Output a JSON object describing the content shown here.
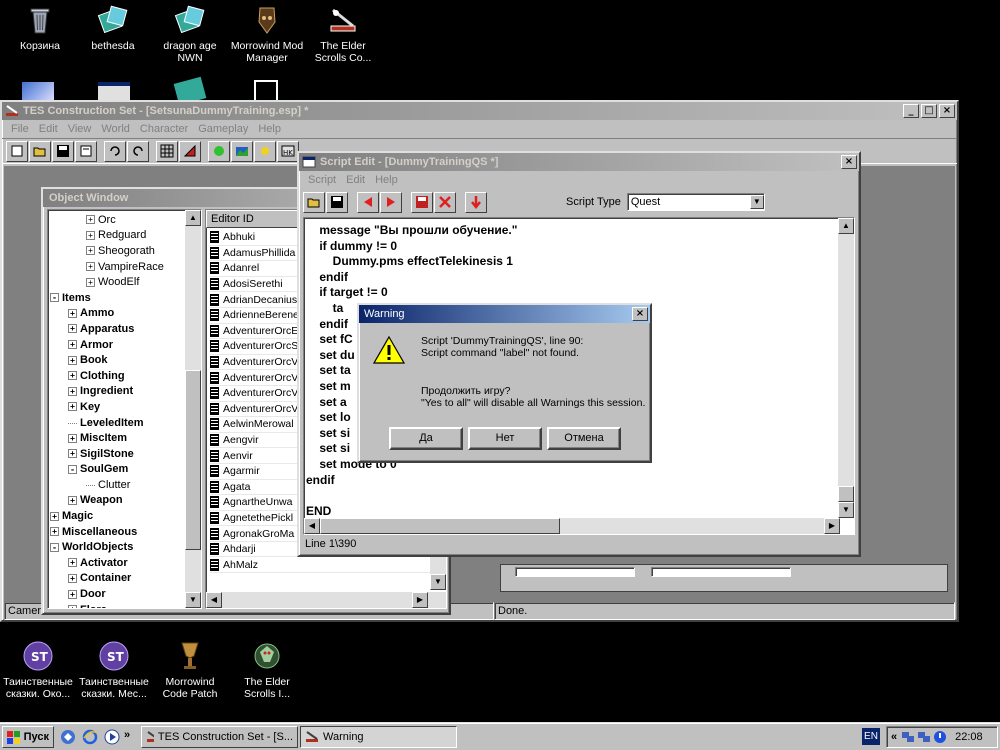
{
  "desktop": {
    "top_icons": [
      {
        "label": "Корзина",
        "icon": "recycle-bin-icon"
      },
      {
        "label": "bethesda",
        "icon": "program-group-icon"
      },
      {
        "label": "dragon age NWN",
        "icon": "program-group-icon"
      },
      {
        "label": "Morrowind Mod Manager",
        "icon": "shield-mask-icon"
      },
      {
        "label": "The Elder Scrolls Co...",
        "icon": "construction-set-icon"
      }
    ],
    "bottom_icons": [
      {
        "label": "Таинственные сказки. Око...",
        "icon": "disc-icon"
      },
      {
        "label": "Таинственные сказки. Мес...",
        "icon": "disc-icon"
      },
      {
        "label": "Morrowind Code Patch",
        "icon": "goblet-icon"
      },
      {
        "label": "The Elder Scrolls I...",
        "icon": "dragon-icon"
      }
    ]
  },
  "main_window": {
    "title": "TES Construction Set - [SetsunaDummyTraining.esp] *",
    "menu": [
      "File",
      "Edit",
      "View",
      "World",
      "Character",
      "Gameplay",
      "Help"
    ],
    "status_left": "Camera",
    "status_right": "Done."
  },
  "object_window": {
    "title": "Object Window",
    "column_header": "Editor ID",
    "tree": [
      {
        "label": "Orc",
        "indent": 2,
        "toggle": "+",
        "bold": false
      },
      {
        "label": "Redguard",
        "indent": 2,
        "toggle": "+",
        "bold": false
      },
      {
        "label": "Sheogorath",
        "indent": 2,
        "toggle": "+",
        "bold": false
      },
      {
        "label": "VampireRace",
        "indent": 2,
        "toggle": "+",
        "bold": false
      },
      {
        "label": "WoodElf",
        "indent": 2,
        "toggle": "+",
        "bold": false
      },
      {
        "label": "Items",
        "indent": 0,
        "toggle": "-",
        "bold": true
      },
      {
        "label": "Ammo",
        "indent": 1,
        "toggle": "+",
        "bold": true
      },
      {
        "label": "Apparatus",
        "indent": 1,
        "toggle": "+",
        "bold": true
      },
      {
        "label": "Armor",
        "indent": 1,
        "toggle": "+",
        "bold": true
      },
      {
        "label": "Book",
        "indent": 1,
        "toggle": "+",
        "bold": true
      },
      {
        "label": "Clothing",
        "indent": 1,
        "toggle": "+",
        "bold": true
      },
      {
        "label": "Ingredient",
        "indent": 1,
        "toggle": "+",
        "bold": true
      },
      {
        "label": "Key",
        "indent": 1,
        "toggle": "+",
        "bold": true
      },
      {
        "label": "LeveledItem",
        "indent": 1,
        "toggle": "",
        "bold": true
      },
      {
        "label": "MiscItem",
        "indent": 1,
        "toggle": "+",
        "bold": true
      },
      {
        "label": "SigilStone",
        "indent": 1,
        "toggle": "+",
        "bold": true
      },
      {
        "label": "SoulGem",
        "indent": 1,
        "toggle": "-",
        "bold": true
      },
      {
        "label": "Clutter",
        "indent": 2,
        "toggle": "",
        "bold": false
      },
      {
        "label": "Weapon",
        "indent": 1,
        "toggle": "+",
        "bold": true
      },
      {
        "label": "Magic",
        "indent": 0,
        "toggle": "+",
        "bold": true
      },
      {
        "label": "Miscellaneous",
        "indent": 0,
        "toggle": "+",
        "bold": true
      },
      {
        "label": "WorldObjects",
        "indent": 0,
        "toggle": "-",
        "bold": true
      },
      {
        "label": "Activator",
        "indent": 1,
        "toggle": "+",
        "bold": true
      },
      {
        "label": "Container",
        "indent": 1,
        "toggle": "+",
        "bold": true
      },
      {
        "label": "Door",
        "indent": 1,
        "toggle": "+",
        "bold": true
      },
      {
        "label": "Flora",
        "indent": 1,
        "toggle": "+",
        "bold": true
      }
    ],
    "list": [
      "Abhuki",
      "AdamusPhillida",
      "Adanrel",
      "AdosiSerethi",
      "AdrianDecanius",
      "AdrienneBerene",
      "AdventurerOrcE",
      "AdventurerOrcS",
      "AdventurerOrcV",
      "AdventurerOrcV",
      "AdventurerOrcV",
      "AdventurerOrcV",
      "AelwinMerowal",
      "Aengvir",
      "Aenvir",
      "Agarmir",
      "Agata",
      "AgnartheUnwa",
      "AgnetethePickl",
      "AgronakGroMa",
      "Ahdarji",
      "AhMalz"
    ]
  },
  "script_edit": {
    "title": "Script Edit - [DummyTrainingQS *]",
    "menu": [
      "Script",
      "Edit",
      "Help"
    ],
    "script_type_label": "Script Type",
    "script_type_value": "Quest",
    "code_lines": [
      "    message \"Вы прошли обучение.\"",
      "    if dummy != 0",
      "        Dummy.pms effectTelekinesis 1",
      "    endif",
      "    if target != 0",
      "        ta",
      "    endif",
      "    set fC",
      "    set du",
      "    set ta",
      "    set m",
      "    set a",
      "    set lo",
      "    set si",
      "    set si",
      "    set mode to 0",
      "endif",
      "",
      "END"
    ],
    "status": "Line 1\\390"
  },
  "warning_dialog": {
    "title": "Warning",
    "line1": "Script 'DummyTrainingQS', line 90:",
    "line2": "Script command \"label\" not found.",
    "line3": "Продолжить игру?",
    "line4": "\"Yes to all\" will disable all Warnings this session.",
    "buttons": [
      "Да",
      "Нет",
      "Отмена"
    ]
  },
  "taskbar": {
    "start_label": "Пуск",
    "tasks": [
      "TES Construction Set - [S...",
      "Warning"
    ],
    "lang": "EN",
    "clock": "22:08"
  }
}
